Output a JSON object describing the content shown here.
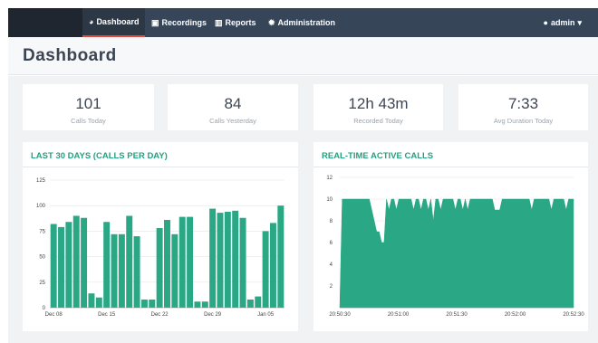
{
  "nav": {
    "items": [
      {
        "icon": "dashboard-icon",
        "label": "Dashboard",
        "active": true
      },
      {
        "icon": "recordings-icon",
        "label": "Recordings",
        "active": false
      },
      {
        "icon": "reports-icon",
        "label": "Reports",
        "active": false
      },
      {
        "icon": "gear-icon",
        "label": "Administration",
        "active": false
      }
    ],
    "user": "admin"
  },
  "page_title": "Dashboard",
  "stats": [
    {
      "value": "101",
      "label": "Calls Today"
    },
    {
      "value": "84",
      "label": "Calls Yesterday"
    },
    {
      "value": "12h 43m",
      "label": "Recorded Today"
    },
    {
      "value": "7:33",
      "label": "Avg Duration Today"
    }
  ],
  "panels": {
    "left_title": "LAST 30 DAYS (CALLS PER DAY)",
    "right_title": "REAL-TIME ACTIVE CALLS"
  },
  "colors": {
    "accent": "#2aa784",
    "nav_bg": "#364558",
    "active_underline": "#e14a3c"
  },
  "chart_data": [
    {
      "type": "bar",
      "title": "LAST 30 DAYS (CALLS PER DAY)",
      "ylim": [
        0,
        125
      ],
      "yticks": [
        "0",
        "25",
        "50",
        "75",
        "100",
        "125"
      ],
      "xticks": [
        {
          "label": "Dec 08",
          "index": 0
        },
        {
          "label": "Dec 15",
          "index": 7
        },
        {
          "label": "Dec 22",
          "index": 14
        },
        {
          "label": "Dec 29",
          "index": 21
        },
        {
          "label": "Jan 05",
          "index": 28
        }
      ],
      "values": [
        82,
        79,
        84,
        90,
        88,
        14,
        10,
        84,
        72,
        72,
        90,
        70,
        8,
        8,
        78,
        86,
        72,
        89,
        89,
        6,
        6,
        97,
        93,
        94,
        95,
        88,
        8,
        11,
        75,
        83,
        100
      ],
      "grid": true
    },
    {
      "type": "area",
      "title": "REAL-TIME ACTIVE CALLS",
      "ylim": [
        0,
        12
      ],
      "yticks": [
        "2",
        "4",
        "6",
        "8",
        "10",
        "12"
      ],
      "xticks": [
        "20:50:30",
        "20:51:00",
        "20:51:30",
        "20:52:00",
        "20:52:30"
      ],
      "values": [
        0,
        10,
        10,
        10,
        10,
        10,
        10,
        10,
        10,
        10,
        10,
        10,
        10,
        9,
        8,
        7,
        7,
        6,
        6,
        10,
        9,
        10,
        10,
        9,
        10,
        10,
        10,
        10,
        10,
        10,
        9,
        10,
        10,
        9,
        10,
        10,
        9,
        10,
        8,
        10,
        10,
        9,
        10,
        10,
        10,
        10,
        10,
        9,
        10,
        10,
        9,
        10,
        9,
        10,
        10,
        10,
        10,
        10,
        10,
        10,
        10,
        10,
        10,
        9,
        9,
        9,
        10,
        10,
        10,
        10,
        10,
        10,
        10,
        10,
        10,
        10,
        10,
        10,
        9,
        10,
        10,
        10,
        10,
        10,
        10,
        10,
        9,
        10,
        10,
        10,
        10,
        10,
        9,
        10,
        10,
        10
      ],
      "grid": true
    }
  ]
}
